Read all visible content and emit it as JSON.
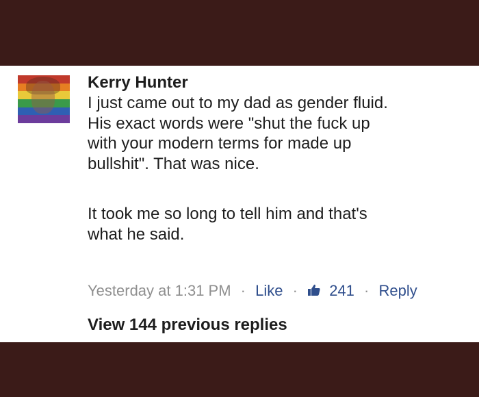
{
  "comment": {
    "author": "Kerry Hunter",
    "paragraph1": [
      "I just came out to my dad as gender fluid.",
      "His exact words were \"shut the fuck up",
      "with your modern terms for made up",
      "bullshit\". That was nice."
    ],
    "paragraph2": [
      "It took me so long to tell him and that's",
      "what he said."
    ],
    "timestamp": "Yesterday at 1:31 PM",
    "separator": "·",
    "like_label": "Like",
    "like_count": "241",
    "reply_label": "Reply",
    "like_icon": "thumbs-up-icon"
  },
  "view_replies_label": "View 144 previous replies",
  "avatar": {
    "icon": "profile-avatar-rainbow",
    "rainbow_colors": [
      "#c0392b",
      "#e67e22",
      "#e9c93a",
      "#3a9a4a",
      "#2f5fb3",
      "#6c3c9c"
    ]
  },
  "colors": {
    "frame_background": "#3b1b18",
    "card_background": "#ffffff",
    "text": "#1d1d1d",
    "meta_gray": "#8f8f8f",
    "link_blue": "#2f4e8c"
  }
}
